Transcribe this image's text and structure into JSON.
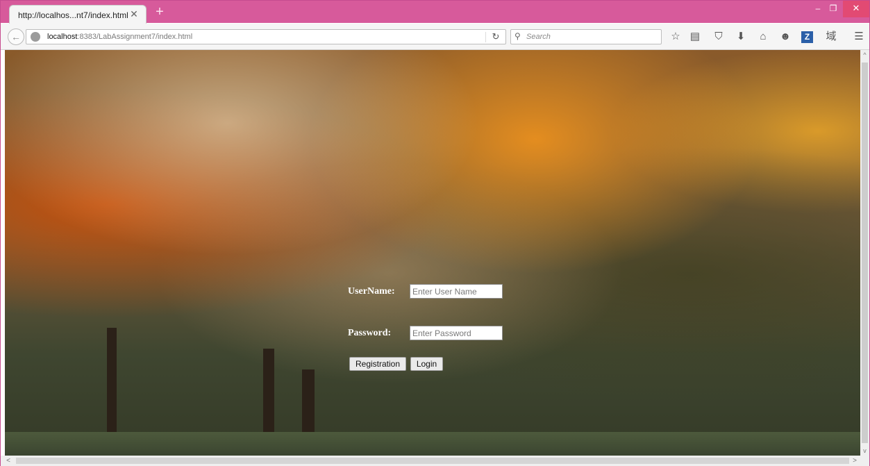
{
  "browser": {
    "tab_title": "http://localhos...nt7/index.html",
    "tab_close": "✕",
    "new_tab": "+",
    "url_host": "localhost",
    "url_rest": ":8383/LabAssignment7/index.html",
    "reload": "↻",
    "search_placeholder": "Search",
    "window_buttons": {
      "minimize": "–",
      "maximize": "❐",
      "close": "✕"
    },
    "toolbar_icons": [
      "star-icon",
      "reading-list-icon",
      "pocket-icon",
      "download-icon",
      "home-icon",
      "chat-icon",
      "zotero-icon",
      "translate-icon",
      "menu-icon"
    ],
    "toolbar_glyphs": {
      "star": "☆",
      "reading_list": "▤",
      "pocket": "⛉",
      "download": "⬇",
      "home": "⌂",
      "chat": "☻",
      "zotero": "Z",
      "translate": "域",
      "menu": "☰"
    }
  },
  "login_form": {
    "username_label": "UserName:",
    "username_placeholder": "Enter User Name",
    "password_label": "Password:",
    "password_placeholder": "Enter Password",
    "registration_button": "Registration",
    "login_button": "Login"
  },
  "scrollbars": {
    "up": "^",
    "down": "v",
    "left": "<",
    "right": ">"
  }
}
